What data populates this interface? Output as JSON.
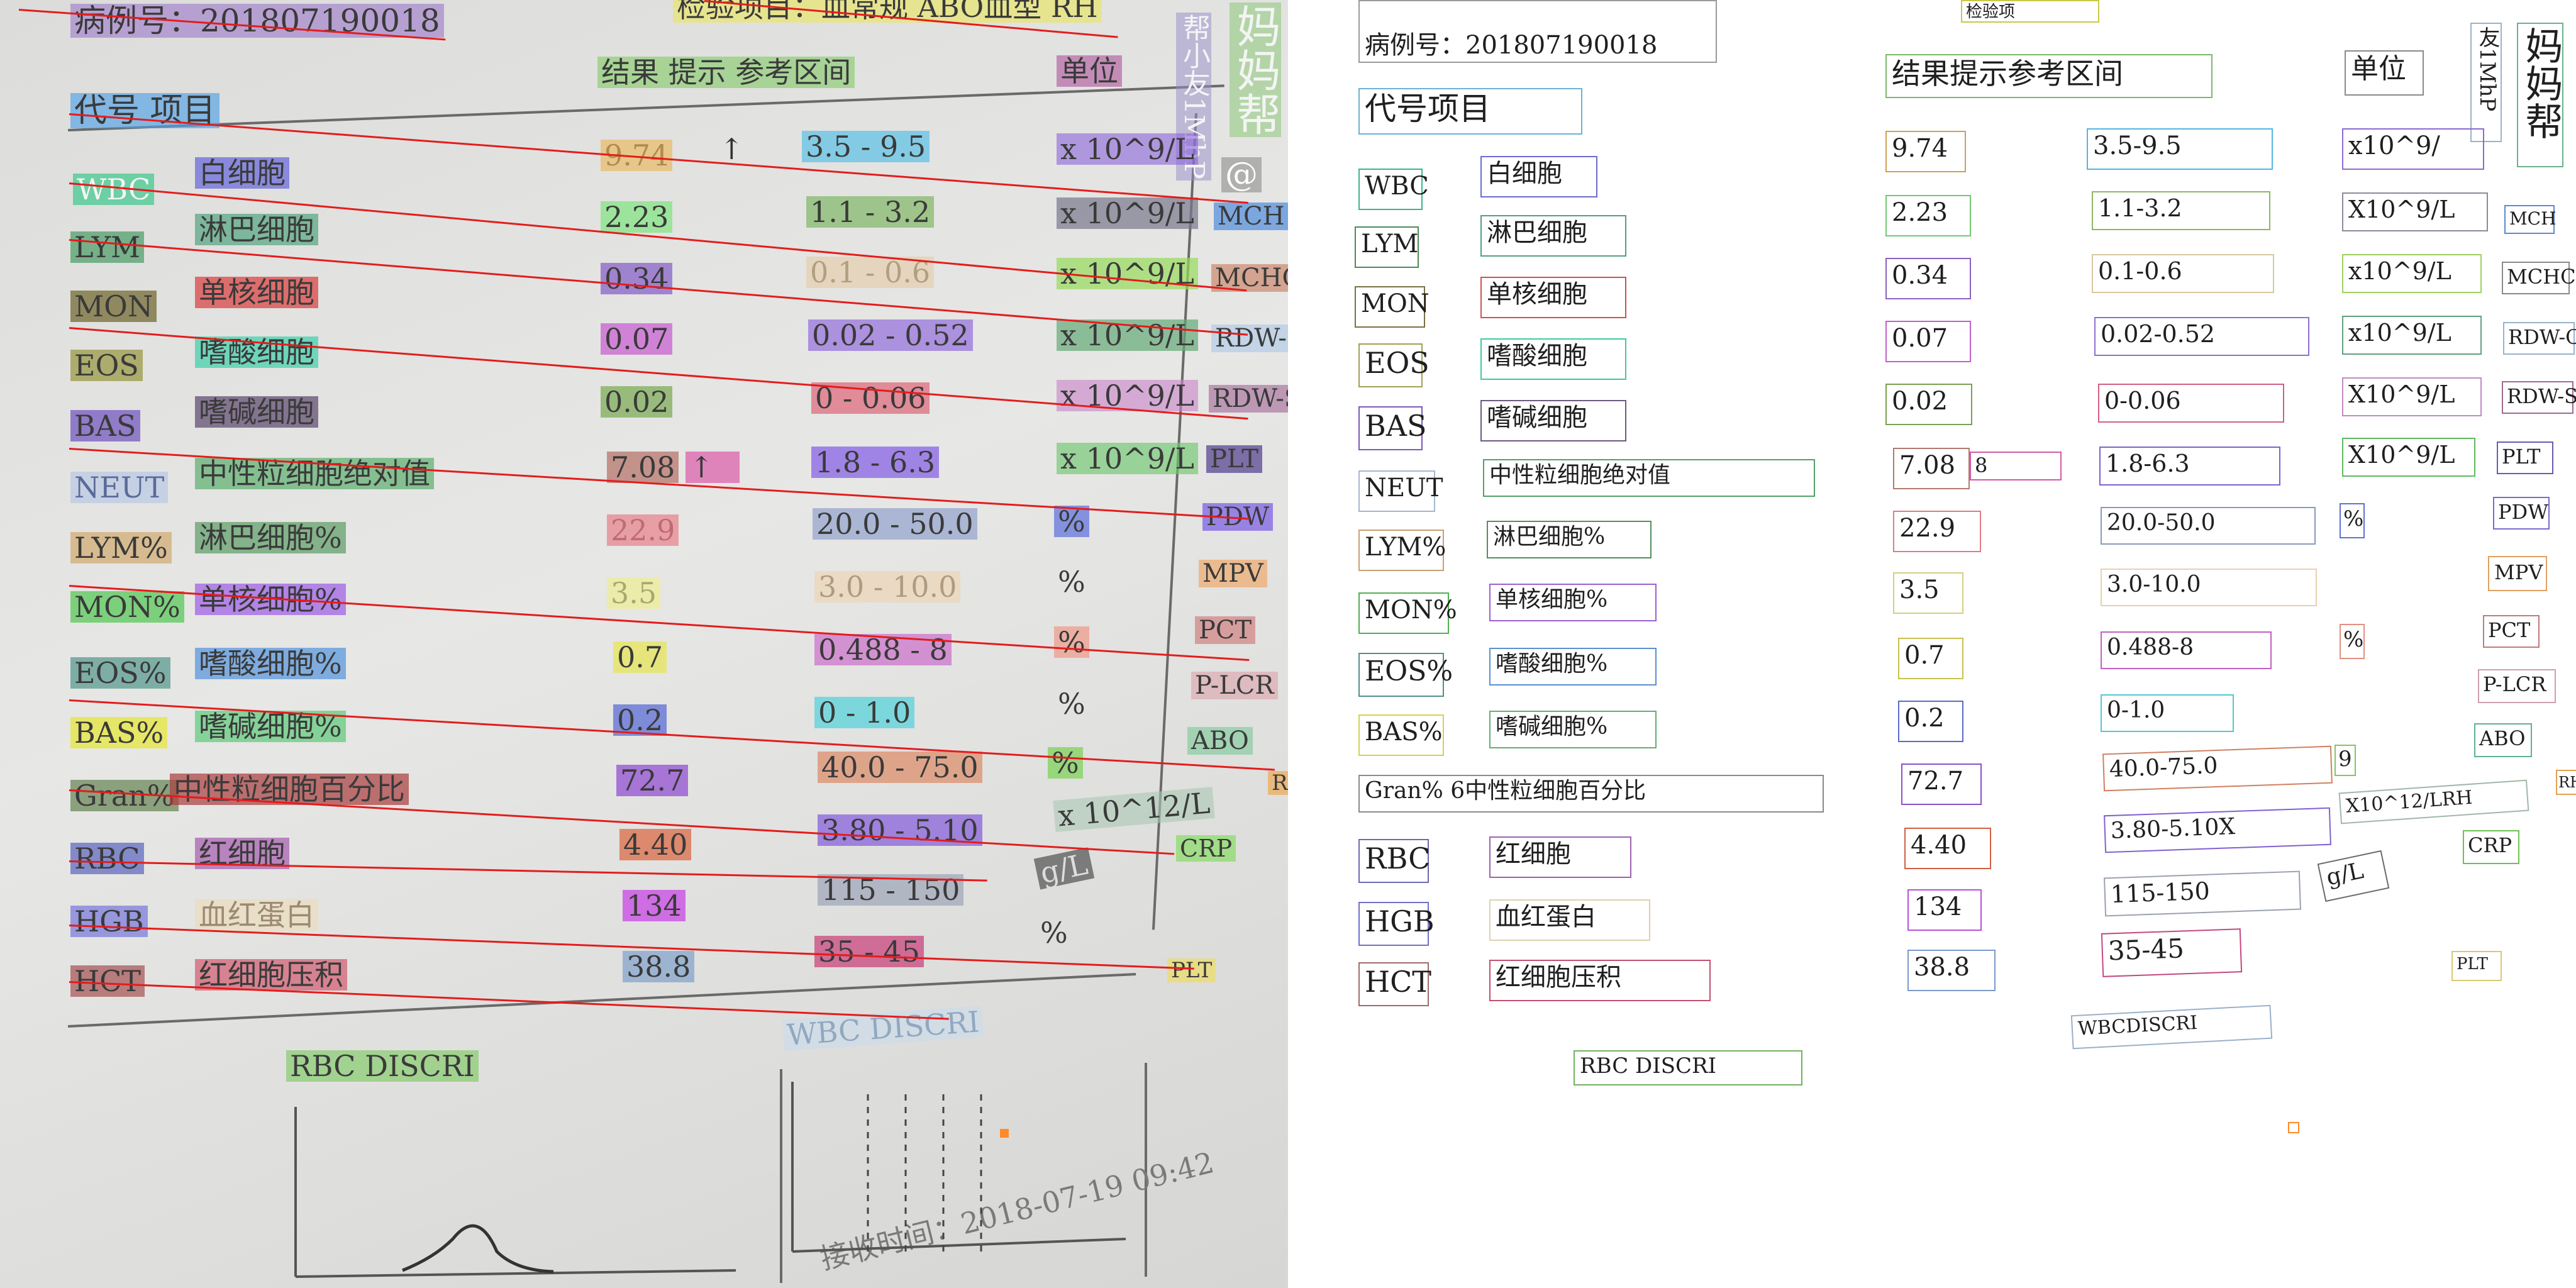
{
  "header": {
    "case_label": "病例号：201807190018",
    "test_label": "检验项目：血常规 ABO血型 RH",
    "test_short": "检验项",
    "result_header": "结果 提示 参考区间",
    "result_header_compact": "结果提示参考区间",
    "unit_header": "单位",
    "code_header": "代号 项目",
    "code_header_compact": "代号项目"
  },
  "watermark": {
    "brand": "妈妈帮",
    "camera": "帮小友1MhP",
    "camera_compact": "友1MhP",
    "at": "@"
  },
  "rows": [
    {
      "code": "WBC",
      "name": "白细胞",
      "result": "9.74",
      "flag": "↑",
      "ref": "3.5 - 9.5",
      "ref_compact": "3.5-9.5",
      "unit": "x 10^9/L",
      "unit_compact": "x10^9/"
    },
    {
      "code": "LYM",
      "name": "淋巴细胞",
      "result": "2.23",
      "flag": "",
      "ref": "1.1 - 3.2",
      "ref_compact": "1.1-3.2",
      "unit": "x 10^9/L",
      "unit_compact": "X10^9/L"
    },
    {
      "code": "MON",
      "name": "单核细胞",
      "result": "0.34",
      "flag": "",
      "ref": "0.1 - 0.6",
      "ref_compact": "0.1-0.6",
      "unit": "x 10^9/L",
      "unit_compact": "x10^9/L"
    },
    {
      "code": "EOS",
      "name": "嗜酸细胞",
      "result": "0.07",
      "flag": "",
      "ref": "0.02 - 0.52",
      "ref_compact": "0.02-0.52",
      "unit": "x 10^9/L",
      "unit_compact": "x10^9/L"
    },
    {
      "code": "BAS",
      "name": "嗜碱细胞",
      "result": "0.02",
      "flag": "",
      "ref": "0 - 0.06",
      "ref_compact": "0-0.06",
      "unit": "x 10^9/L",
      "unit_compact": "X10^9/L"
    },
    {
      "code": "NEUT",
      "name": "中性粒细胞绝对值",
      "result": "7.08",
      "flag": "↑",
      "ref": "1.8 - 6.3",
      "ref_compact": "1.8-6.3",
      "unit": "x 10^9/L",
      "unit_compact": "X10^9/L"
    },
    {
      "code": "LYM%",
      "name": "淋巴细胞%",
      "result": "22.9",
      "flag": "",
      "ref": "20.0 - 50.0",
      "ref_compact": "20.0-50.0",
      "unit": "%",
      "unit_compact": "%"
    },
    {
      "code": "MON%",
      "name": "单核细胞%",
      "result": "3.5",
      "flag": "",
      "ref": "3.0 - 10.0",
      "ref_compact": "3.0-10.0",
      "unit": "%",
      "unit_compact": ""
    },
    {
      "code": "EOS%",
      "name": "嗜酸细胞%",
      "result": "0.7",
      "flag": "",
      "ref": "0.488 - 8",
      "ref_compact": "0.488-8",
      "unit": "%",
      "unit_compact": "%"
    },
    {
      "code": "BAS%",
      "name": "嗜碱细胞%",
      "result": "0.2",
      "flag": "",
      "ref": "0 - 1.0",
      "ref_compact": "0-1.0",
      "unit": "%",
      "unit_compact": ""
    },
    {
      "code": "Gran%",
      "name": "中性粒细胞百分比",
      "result": "72.7",
      "flag": "",
      "ref": "40.0 - 75.0",
      "ref_compact": "40.0-75.0",
      "unit": "%",
      "unit_compact": "9"
    },
    {
      "code": "RBC",
      "name": "红细胞",
      "result": "4.40",
      "flag": "",
      "ref": "3.80 - 5.10",
      "ref_compact": "3.80-5.10X",
      "unit": "x 10^12/L",
      "unit_compact": "X10^12/LRH"
    },
    {
      "code": "HGB",
      "name": "血红蛋白",
      "result": "134",
      "flag": "",
      "ref": "115 - 150",
      "ref_compact": "115-150",
      "unit": "g/L",
      "unit_compact": "g/L"
    },
    {
      "code": "HCT",
      "name": "红细胞压积",
      "result": "38.8",
      "flag": "",
      "ref": "35 - 45",
      "ref_compact": "35-45",
      "unit": "%",
      "unit_compact": ""
    }
  ],
  "right_codes": [
    "MCH",
    "MCHC",
    "RDW-C",
    "RDW-S",
    "PLT",
    "PDW",
    "MPV",
    "PCT",
    "P-LCR",
    "ABO",
    "RH",
    "CRP",
    "PLT"
  ],
  "footer": {
    "rbc_discri": "RBC DISCRI",
    "wbc_discri": "WBC DISCRI",
    "wbc_discri_compact": "WBCDISCRI",
    "received_time": "接收时间：2018-07-19 09:42"
  },
  "recon_extra": {
    "gran_prefix": "Gran% 6中性粒细胞百分比",
    "neut_extra": "8"
  },
  "colors": {
    "annotation_line": "#e31c1c",
    "paper": "#e2e2e0"
  }
}
